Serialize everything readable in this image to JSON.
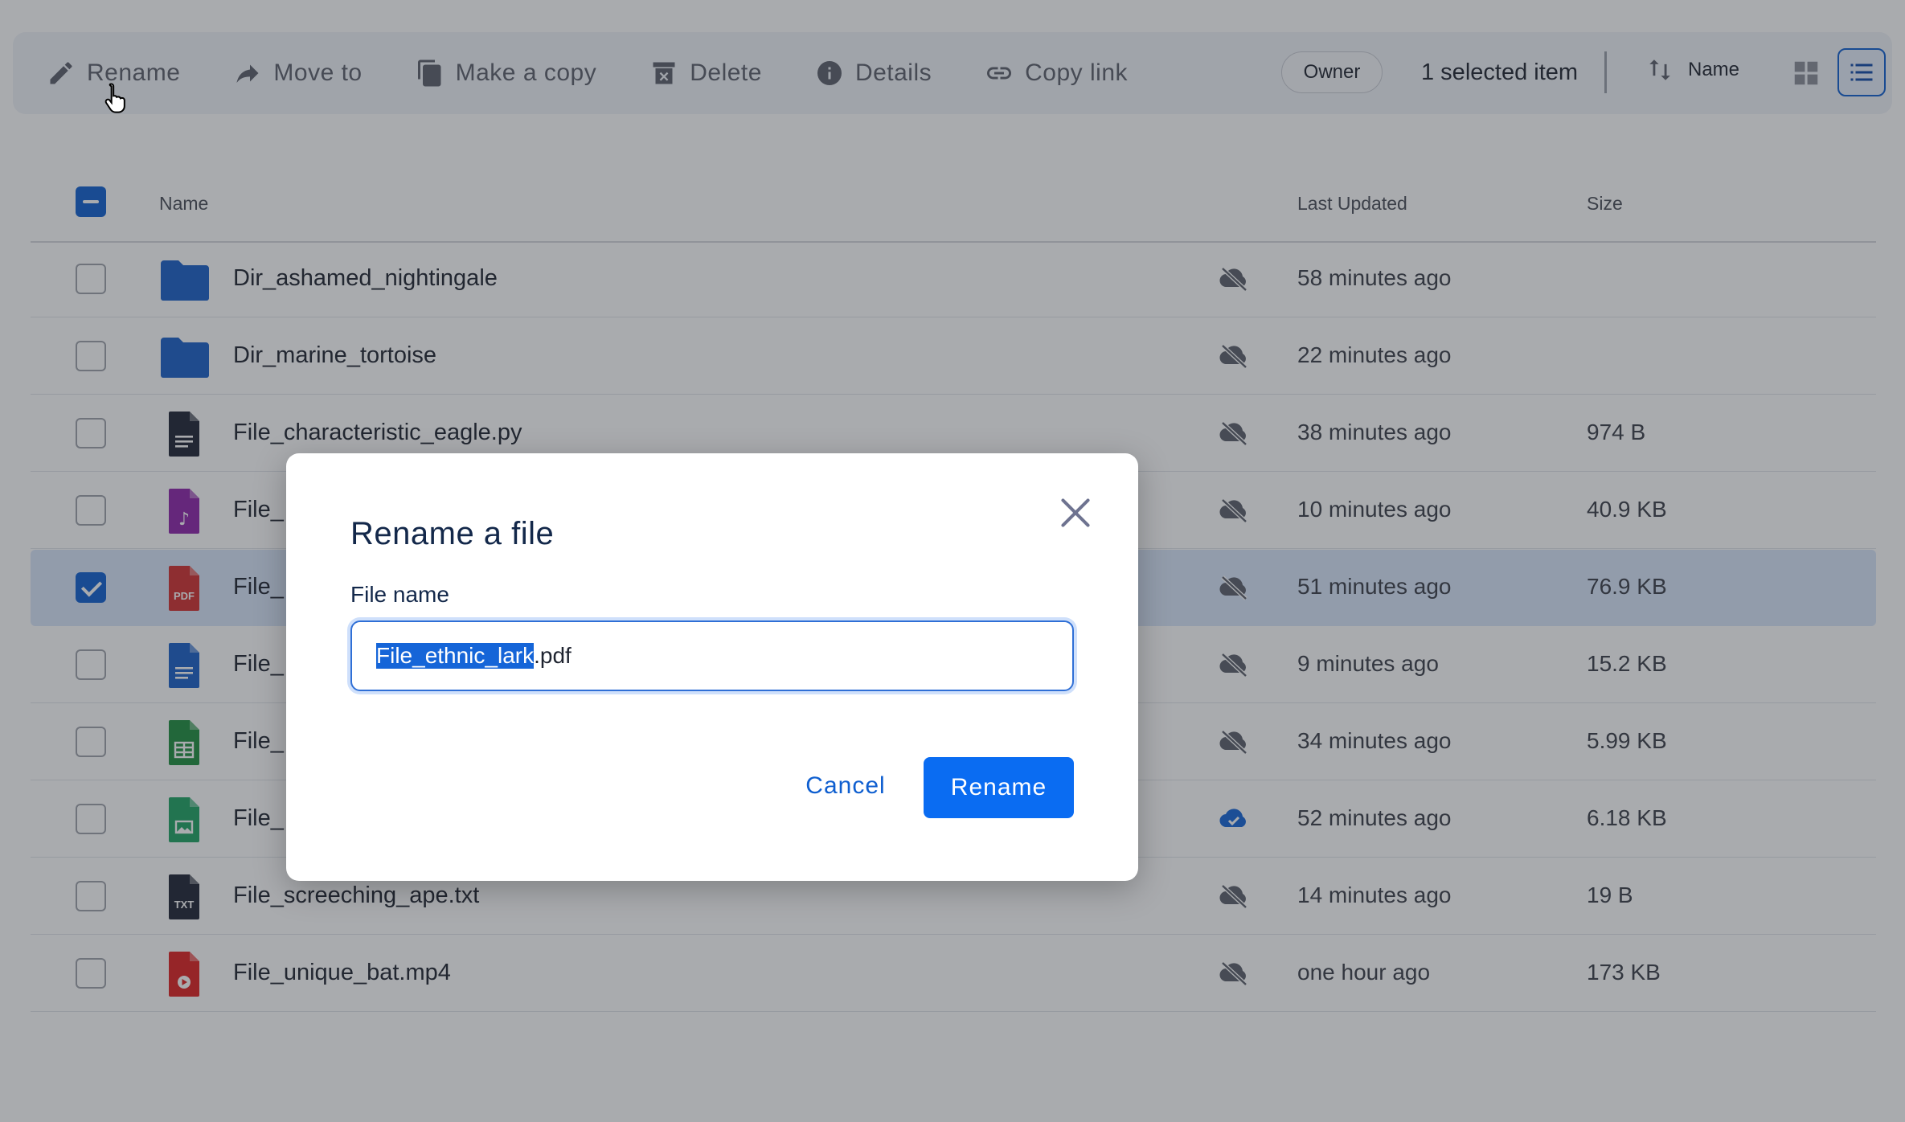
{
  "toolbar": {
    "actions": [
      {
        "label": "Rename",
        "icon": "pencil-icon"
      },
      {
        "label": "Move to",
        "icon": "move-arrow-icon"
      },
      {
        "label": "Make a copy",
        "icon": "copy-icon"
      },
      {
        "label": "Delete",
        "icon": "trash-icon"
      },
      {
        "label": "Details",
        "icon": "info-icon"
      },
      {
        "label": "Copy link",
        "icon": "link-icon"
      }
    ],
    "owner_filter": "Owner",
    "selected_count": "1 selected item",
    "sort_label": "Name"
  },
  "table": {
    "headers": {
      "name": "Name",
      "updated": "Last Updated",
      "size": "Size"
    },
    "rows": [
      {
        "name": "Dir_ashamed_nightingale",
        "type": "folder",
        "sync": "not-synced",
        "updated": "58 minutes ago",
        "size": "",
        "checked": false
      },
      {
        "name": "Dir_marine_tortoise",
        "type": "folder",
        "sync": "not-synced",
        "updated": "22 minutes ago",
        "size": "",
        "checked": false
      },
      {
        "name": "File_characteristic_eagle.py",
        "type": "code",
        "sync": "not-synced",
        "updated": "38 minutes ago",
        "size": "974 B",
        "checked": false
      },
      {
        "name": "File_",
        "type": "audio",
        "sync": "not-synced",
        "updated": "10 minutes ago",
        "size": "40.9 KB",
        "checked": false
      },
      {
        "name": "File_",
        "type": "pdf",
        "sync": "not-synced",
        "updated": "51 minutes ago",
        "size": "76.9 KB",
        "checked": true
      },
      {
        "name": "File_",
        "type": "doc",
        "sync": "not-synced",
        "updated": "9 minutes ago",
        "size": "15.2 KB",
        "checked": false
      },
      {
        "name": "File_",
        "type": "sheet",
        "sync": "not-synced",
        "updated": "34 minutes ago",
        "size": "5.99 KB",
        "checked": false
      },
      {
        "name": "File_",
        "type": "image",
        "sync": "synced",
        "updated": "52 minutes ago",
        "size": "6.18 KB",
        "checked": false
      },
      {
        "name": "File_screeching_ape.txt",
        "type": "txt",
        "sync": "not-synced",
        "updated": "14 minutes ago",
        "size": "19 B",
        "checked": false
      },
      {
        "name": "File_unique_bat.mp4",
        "type": "video",
        "sync": "not-synced",
        "updated": "one hour ago",
        "size": "173 KB",
        "checked": false
      }
    ]
  },
  "dialog": {
    "title": "Rename a file",
    "field_label": "File name",
    "value_selected": "File_ethnic_lark",
    "value_rest": ".pdf",
    "cancel_label": "Cancel",
    "confirm_label": "Rename"
  },
  "icon_labels": {
    "pdf": "PDF",
    "txt": "TXT"
  },
  "colors": {
    "accent": "#0a6cf2",
    "folder": "#1a5fc8",
    "pdf": "#d32f2f",
    "audio": "#8e24aa",
    "sheet": "#1e8e3e",
    "image": "#1fa463",
    "code": "#1f2435",
    "video": "#e02020"
  }
}
